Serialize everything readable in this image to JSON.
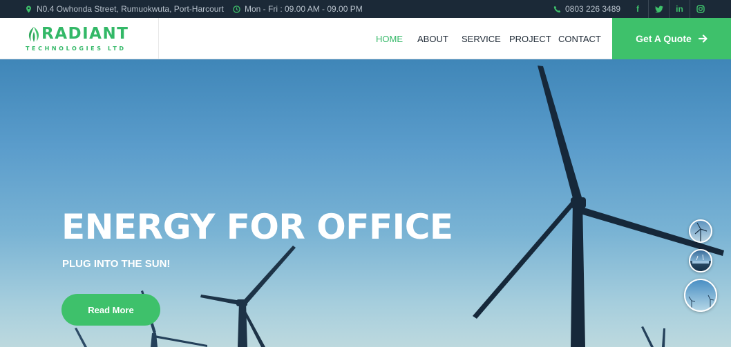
{
  "topbar": {
    "address": "N0.4 Owhonda Street, Rumuokwuta, Port-Harcourt",
    "hours": "Mon - Fri : 09.00 AM - 09.00 PM",
    "phone": "0803 226 3489",
    "socials": [
      {
        "icon": "facebook-icon",
        "glyph": "f"
      },
      {
        "icon": "twitter-icon",
        "glyph": "t"
      },
      {
        "icon": "linkedin-icon",
        "glyph": "in"
      },
      {
        "icon": "instagram-icon",
        "glyph": "◎"
      }
    ]
  },
  "header": {
    "logo_name": "RADIANT",
    "logo_sub": "TECHNOLOGIES LTD",
    "nav": {
      "home": "HOME",
      "about": "ABOUT",
      "service": "SERVICE",
      "project": "PROJECT",
      "contact": "CONTACT"
    },
    "active_nav": "HOME",
    "quote_label": "Get A Quote",
    "quote_icon": "arrow-right-icon"
  },
  "hero": {
    "title": "ENERGY FOR OFFICE",
    "subtitle": "PLUG INTO THE SUN!",
    "button_label": "Read More"
  },
  "colors": {
    "accent": "#3ec16b",
    "topbar_bg": "#1b2937",
    "nav_text": "#1f2a36"
  }
}
